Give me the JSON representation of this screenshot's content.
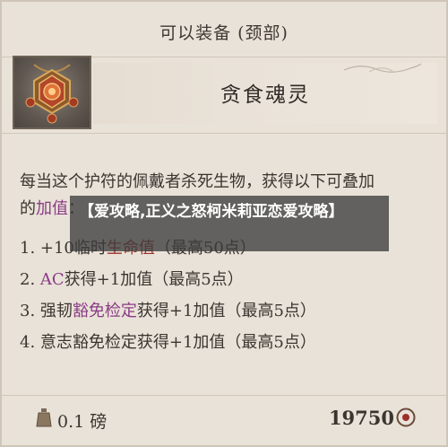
{
  "header": {
    "title": "可以装备 (颈部)"
  },
  "item": {
    "name": "贪食魂灵",
    "icon": "amulet-icon"
  },
  "description": {
    "line1": "每当这个护符的佩戴者杀死生物，获得以下可叠加",
    "line2_prefix": "的",
    "line2_highlight": "加值",
    "line2_suffix": "："
  },
  "bonuses": [
    {
      "prefix": "1. +10临时",
      "highlight": "生命值",
      "highlight_color": "red",
      "suffix": "（最高50点）"
    },
    {
      "prefix": "2. ",
      "highlight": "AC",
      "highlight_color": "purple",
      "suffix": "获得+1加值（最高5点）"
    },
    {
      "prefix": "3. 强韧",
      "highlight": "豁免检定",
      "highlight_color": "purple",
      "suffix": "获得+1加值（最高5点）"
    },
    {
      "prefix": "4. 意志豁免检定获得+1加值（最高5点）",
      "highlight": "",
      "highlight_color": "",
      "suffix": ""
    }
  ],
  "footer": {
    "weight": "0.1 磅",
    "price": "19750",
    "weight_icon": "weight-icon",
    "coin_icon": "coin-icon"
  },
  "overlay": {
    "text": "【爱攻略,正义之怒柯米莉亚恋爱攻略】"
  },
  "colors": {
    "accent_red": "#9d2f2a",
    "accent_purple": "#8a3c86",
    "background": "#e9e2d8"
  }
}
